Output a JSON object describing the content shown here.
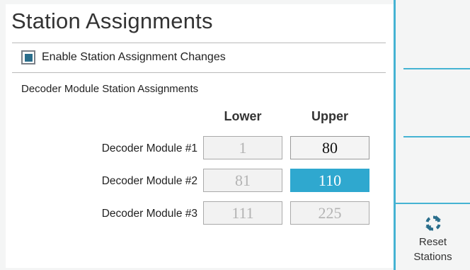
{
  "page": {
    "title": "Station Assignments"
  },
  "enable": {
    "label": "Enable Station Assignment Changes",
    "checked": true
  },
  "section": {
    "title": "Decoder Module Station Assignments"
  },
  "columns": {
    "lower": "Lower",
    "upper": "Upper"
  },
  "modules": [
    {
      "label": "Decoder Module #1",
      "lower": "1",
      "upper": "80"
    },
    {
      "label": "Decoder Module #2",
      "lower": "81",
      "upper": "110"
    },
    {
      "label": "Decoder Module #3",
      "lower": "111",
      "upper": "225"
    }
  ],
  "sidebar": {
    "reset_line1": "Reset",
    "reset_line2": "Stations",
    "reset_icon": "refresh-icon"
  },
  "colors": {
    "accent": "#45b3d3",
    "selected": "#2fa8cf",
    "checkbox_fill": "#2a6e8c"
  }
}
